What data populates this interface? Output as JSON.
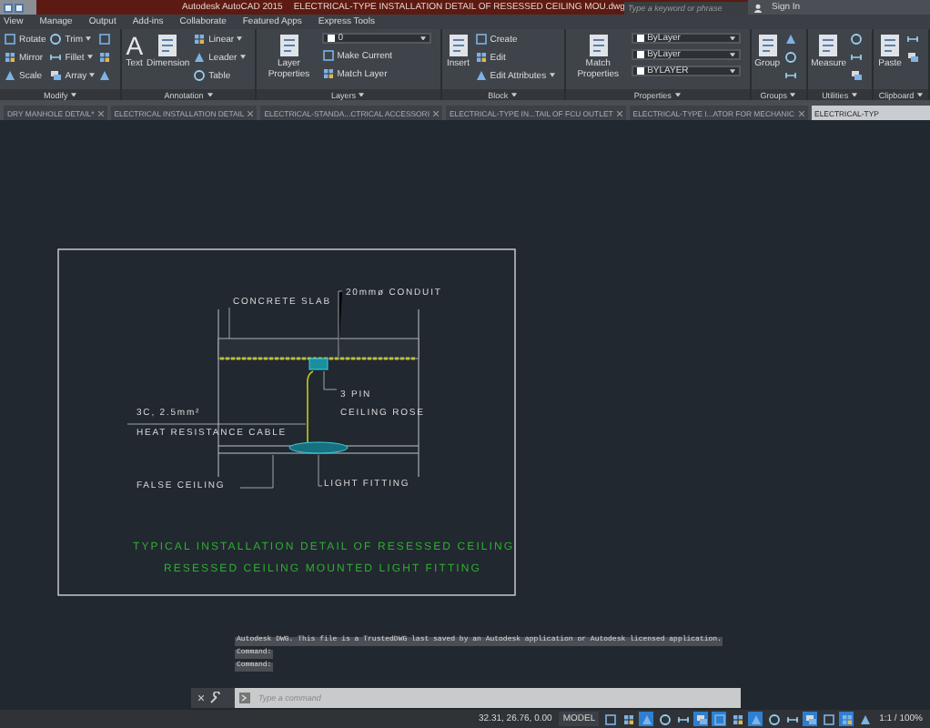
{
  "title_bar": {
    "app_title": "Autodesk AutoCAD 2015",
    "document": "ELECTRICAL-TYPE INSTALLATION DETAIL OF RESESSED CEILING MOU.dwg",
    "search": {
      "placeholder": "Type a keyword or phrase"
    },
    "sign_in": "Sign In"
  },
  "menu": [
    "View",
    "Manage",
    "Output",
    "Add-ins",
    "Collaborate",
    "Featured Apps",
    "Express Tools"
  ],
  "ribbon": {
    "panels": [
      {
        "title": "Modify",
        "columns": [
          {
            "kind": "stack",
            "rows": [
              {
                "kind": "tool",
                "label": "Rotate"
              },
              {
                "kind": "tool",
                "label": "Mirror"
              },
              {
                "kind": "tool",
                "label": "Scale"
              }
            ]
          },
          {
            "kind": "stack",
            "rows": [
              {
                "kind": "tool",
                "label": "Trim",
                "dropdown": true
              },
              {
                "kind": "tool",
                "label": "Fillet",
                "dropdown": true
              },
              {
                "kind": "tool",
                "label": "Array",
                "dropdown": true
              }
            ]
          },
          {
            "kind": "stack",
            "rows": [
              {
                "kind": "icon"
              },
              {
                "kind": "icon"
              },
              {
                "kind": "icon"
              }
            ]
          }
        ]
      },
      {
        "title": "Annotation",
        "columns": [
          {
            "kind": "large",
            "label": "Text",
            "glyph": "A"
          },
          {
            "kind": "large",
            "label": "Dimension"
          },
          {
            "kind": "stack",
            "rows": [
              {
                "kind": "tool",
                "label": "Linear",
                "dropdown": true
              },
              {
                "kind": "tool",
                "label": "Leader",
                "dropdown": true
              },
              {
                "kind": "tool",
                "label": "Table"
              }
            ]
          }
        ]
      },
      {
        "title": "Layers",
        "columns": [
          {
            "kind": "large",
            "label": "Layer Properties"
          },
          {
            "kind": "stack",
            "rows": [
              {
                "kind": "combo",
                "value": "0"
              },
              {
                "kind": "tool",
                "label": "Make Current"
              },
              {
                "kind": "tool",
                "label": "Match Layer"
              }
            ]
          }
        ]
      },
      {
        "title": "Block",
        "columns": [
          {
            "kind": "large",
            "label": "Insert"
          },
          {
            "kind": "stack",
            "rows": [
              {
                "kind": "tool",
                "label": "Create"
              },
              {
                "kind": "tool",
                "label": "Edit"
              },
              {
                "kind": "tool",
                "label": "Edit Attributes",
                "dropdown": true
              }
            ]
          }
        ]
      },
      {
        "title": "Properties",
        "columns": [
          {
            "kind": "large",
            "label": "Match Properties"
          },
          {
            "kind": "stack",
            "rows": [
              {
                "kind": "combo",
                "value": "ByLayer"
              },
              {
                "kind": "combo",
                "value": "ByLayer"
              },
              {
                "kind": "combo",
                "value": "BYLAYER"
              }
            ]
          }
        ]
      },
      {
        "title": "Groups",
        "columns": [
          {
            "kind": "large",
            "label": "Group"
          },
          {
            "kind": "stack",
            "rows": [
              {
                "kind": "icon"
              },
              {
                "kind": "icon"
              },
              {
                "kind": "icon"
              }
            ]
          }
        ]
      },
      {
        "title": "Utilities",
        "columns": [
          {
            "kind": "large",
            "label": "Measure"
          },
          {
            "kind": "stack",
            "rows": [
              {
                "kind": "icon"
              },
              {
                "kind": "icon"
              },
              {
                "kind": "icon"
              }
            ]
          }
        ]
      },
      {
        "title": "Clipboard",
        "columns": [
          {
            "kind": "large",
            "label": "Paste"
          },
          {
            "kind": "stack",
            "rows": [
              {
                "kind": "icon"
              },
              {
                "kind": "icon"
              }
            ]
          }
        ]
      }
    ]
  },
  "file_tabs": [
    {
      "label": "DRY MANHOLE DETAIL*",
      "selected": false
    },
    {
      "label": "ELECTRICAL INSTALLATION DETAIL",
      "selected": false
    },
    {
      "label": "ELECTRICAL-STANDA...CTRICAL ACCESSORI",
      "selected": false
    },
    {
      "label": "ELECTRICAL-TYPE IN...TAIL OF FCU OUTLET",
      "selected": false
    },
    {
      "label": "ELECTRICAL-TYPE I...ATOR FOR MECHANIC",
      "selected": false
    },
    {
      "label": "ELECTRICAL-TYP",
      "selected": true
    }
  ],
  "drawing": {
    "slab_label": "CONCRETE SLAB",
    "conduit_label": "20mmø CONDUIT",
    "rose_label": [
      "3 PIN",
      "CEILING ROSE"
    ],
    "cable_label": [
      "3C, 2.5mm²",
      "HEAT RESISTANCE CABLE"
    ],
    "ceiling_label": "FALSE CEILING",
    "fitting_label": "LIGHT FITTING",
    "title_lines": [
      "TYPICAL INSTALLATION DETAIL OF RESESSED CEILING",
      "RESESSED CEILING  MOUNTED LIGHT FITTING"
    ]
  },
  "command_history": [
    "Autodesk DWG.  This file is a TrustedDWG last saved by an Autodesk application or Autodesk licensed application.",
    "Command:",
    "Command:"
  ],
  "command_line": {
    "placeholder": "Type a command"
  },
  "status_bar": {
    "coordinates": "32.31, 26.76, 0.00",
    "space": "MODEL",
    "toggles": [
      {
        "on": false
      },
      {
        "on": false
      },
      {
        "on": true
      },
      {
        "on": false
      },
      {
        "on": false
      },
      {
        "on": true
      },
      {
        "on": true
      },
      {
        "on": false
      },
      {
        "on": true
      },
      {
        "on": false
      },
      {
        "on": false
      },
      {
        "on": true
      },
      {
        "on": false
      },
      {
        "on": true
      },
      {
        "on": false
      }
    ],
    "scale": "1:1 / 100%"
  }
}
